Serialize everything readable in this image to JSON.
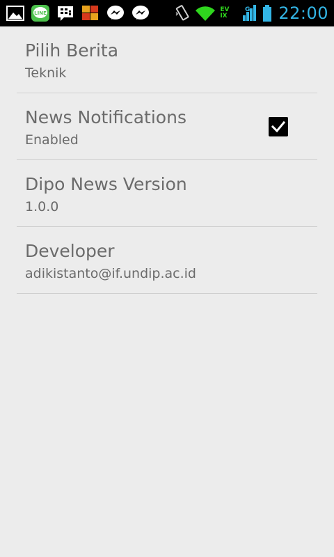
{
  "status_bar": {
    "time": "22:00",
    "network_label_top": "EV",
    "network_label_bottom": "IX",
    "network_type": "G",
    "icons_left": [
      "gallery-icon",
      "line-app-icon",
      "bbm-icon",
      "app-grid-icon",
      "messenger-icon",
      "messenger-icon"
    ],
    "icons_right": [
      "vibrate-icon",
      "wifi-icon",
      "signal-icon",
      "battery-icon"
    ]
  },
  "preferences": [
    {
      "title": "Pilih Berita",
      "summary": "Teknik"
    },
    {
      "title": "News Notifications",
      "summary": "Enabled",
      "checked": true
    },
    {
      "title": "Dipo News Version",
      "summary": "1.0.0"
    },
    {
      "title": "Developer",
      "summary": "adikistanto@if.undip.ac.id"
    }
  ],
  "colors": {
    "clock": "#33b5e5",
    "background": "#ececec",
    "text": "#6b6b6b",
    "divider": "#cfcfcf"
  }
}
